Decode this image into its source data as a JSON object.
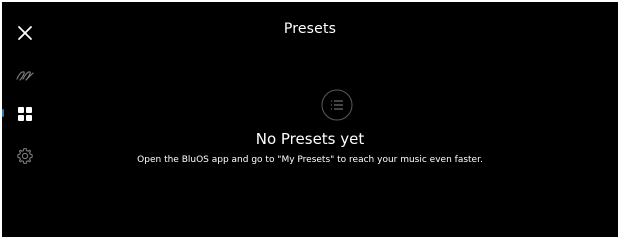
{
  "header": {
    "title": "Presets",
    "close_icon": "close-icon"
  },
  "sidebar": {
    "items": [
      {
        "icon": "signature-icon",
        "active": false
      },
      {
        "icon": "grid-icon",
        "active": true
      },
      {
        "icon": "gear-icon",
        "active": false
      }
    ],
    "active_indicator_color": "#1e7fd0"
  },
  "empty_state": {
    "icon": "list-icon",
    "title": "No Presets yet",
    "message": "Open the BluOS app and go to \"My Presets\" to reach your music even faster."
  },
  "colors": {
    "background": "#000000",
    "text": "#ffffff",
    "muted_icon": "#7a7a7a",
    "accent": "#1e7fd0"
  }
}
